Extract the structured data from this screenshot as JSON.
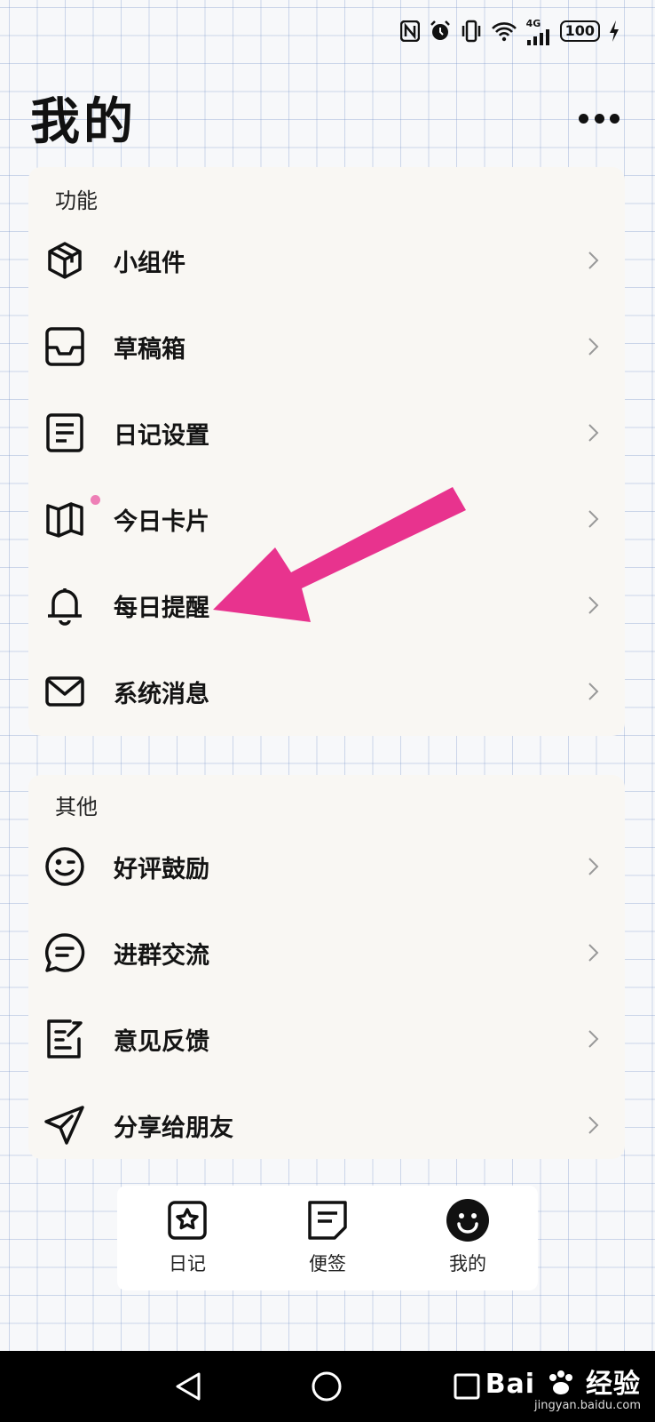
{
  "status_bar": {
    "network": "4G",
    "battery": "100",
    "icons": [
      "nfc-icon",
      "alarm-icon",
      "vibrate-icon",
      "wifi-icon",
      "signal-icon",
      "battery-icon",
      "charging-icon"
    ]
  },
  "header": {
    "title": "我的",
    "more_icon": "more-icon"
  },
  "functions": {
    "section_label": "功能",
    "items": [
      {
        "label": "小组件",
        "icon": "cube-icon"
      },
      {
        "label": "草稿箱",
        "icon": "inbox-icon"
      },
      {
        "label": "日记设置",
        "icon": "document-icon"
      },
      {
        "label": "今日卡片",
        "icon": "book-icon",
        "has_badge": true
      },
      {
        "label": "每日提醒",
        "icon": "bell-icon"
      },
      {
        "label": "系统消息",
        "icon": "mail-icon"
      }
    ]
  },
  "others": {
    "section_label": "其他",
    "items": [
      {
        "label": "好评鼓励",
        "icon": "smile-wink-icon"
      },
      {
        "label": "进群交流",
        "icon": "chat-icon"
      },
      {
        "label": "意见反馈",
        "icon": "edit-icon"
      },
      {
        "label": "分享给朋友",
        "icon": "send-icon"
      }
    ]
  },
  "tab_bar": {
    "tabs": [
      {
        "label": "日记",
        "icon": "star-note-icon",
        "active": false
      },
      {
        "label": "便签",
        "icon": "note-icon",
        "active": false
      },
      {
        "label": "我的",
        "icon": "smiley-icon",
        "active": true
      }
    ]
  },
  "watermark": {
    "brand": "Bai",
    "brand_cn": "经验",
    "url": "jingyan.baidu.com"
  },
  "colors": {
    "annotation_arrow": "#e8338e",
    "badge_dot": "#ee7fb6",
    "card_bg": "#f9f7f3"
  }
}
